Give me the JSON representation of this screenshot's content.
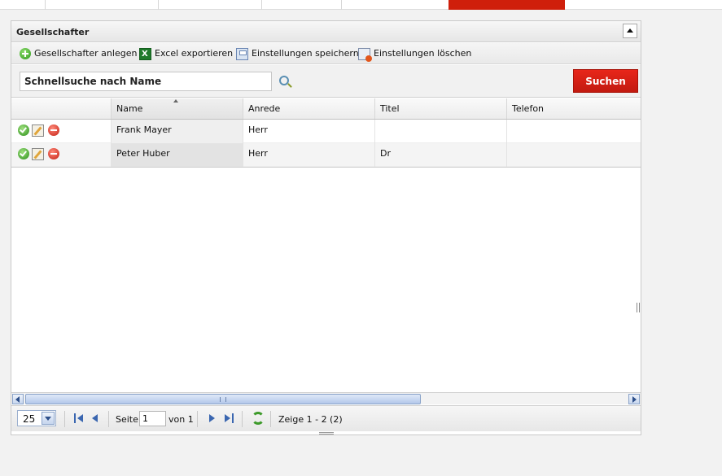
{
  "panel": {
    "title": "Gesellschafter"
  },
  "toolbar": {
    "add_label": "Gesellschafter anlegen",
    "export_label": "Excel exportieren",
    "save_settings_label": "Einstellungen speichern",
    "delete_settings_label": "Einstellungen löschen"
  },
  "search": {
    "placeholder": "Schnellsuche nach Name",
    "button_label": "Suchen"
  },
  "grid": {
    "columns": [
      "",
      "Name",
      "Anrede",
      "Titel",
      "Telefon"
    ],
    "sorted_column": "Name",
    "rows": [
      {
        "name": "Frank Mayer",
        "anrede": "Herr",
        "titel": "",
        "telefon": ""
      },
      {
        "name": "Peter Huber",
        "anrede": "Herr",
        "titel": "Dr",
        "telefon": ""
      }
    ]
  },
  "pager": {
    "page_size": "25",
    "page_label": "Seite",
    "current_page": "1",
    "of_label": "von 1",
    "summary": "Zeige 1 - 2 (2)"
  },
  "colors": {
    "accent_red": "#cf1f0b",
    "button_red": "#d6200f",
    "action_green": "#2e9a1c",
    "pager_blue": "#3a66b0"
  },
  "icons": {
    "add": "add-circle-icon",
    "export": "excel-icon",
    "save": "save-settings-icon",
    "delete": "delete-settings-icon",
    "row_ok": "check-circle-icon",
    "row_edit": "edit-icon",
    "row_remove": "remove-circle-icon",
    "refresh": "refresh-icon"
  }
}
